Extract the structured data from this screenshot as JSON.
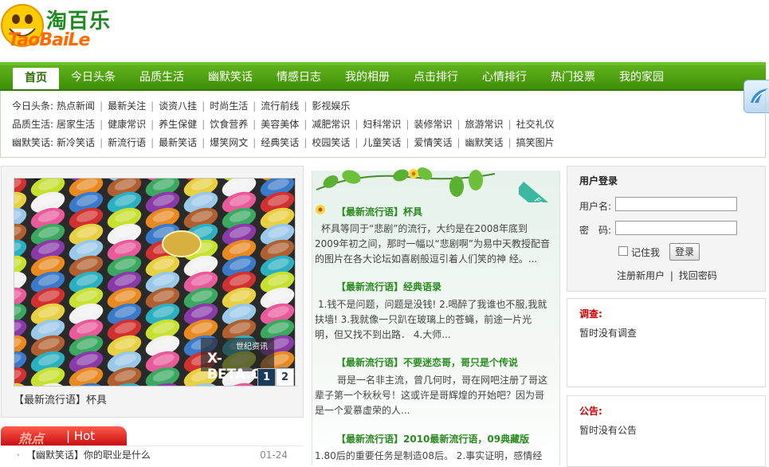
{
  "logo": {
    "cn": "淘百乐",
    "en": "TaoBaiLe"
  },
  "nav": {
    "items": [
      "首页",
      "今日头条",
      "品质生活",
      "幽默笑话",
      "情感日志",
      "我的相册",
      "点击排行",
      "心情排行",
      "热门投票",
      "我的家园"
    ],
    "active_index": 0
  },
  "submenu": {
    "rows": [
      {
        "label": "今日头条:",
        "links": [
          "热点新闻",
          "最新关注",
          "谈资八挂",
          "时尚生活",
          "流行前线",
          "影视娱乐"
        ]
      },
      {
        "label": "品质生活:",
        "links": [
          "居家生活",
          "健康常识",
          "养生保健",
          "饮食营养",
          "美容美体",
          "减肥常识",
          "妇科常识",
          "装修常识",
          "旅游常识",
          "社交礼仪"
        ]
      },
      {
        "label": "幽默笑话:",
        "links": [
          "新冷笑话",
          "新流行语",
          "最新笑话",
          "爆笑网文",
          "经典笑话",
          "校园笑话",
          "儿童笑话",
          "爱情笑话",
          "幽默笑话",
          "搞笑图片"
        ]
      }
    ]
  },
  "slideshow": {
    "caption": "【最新流行语】杯具",
    "watermark_small": "世纪资讯",
    "watermark_big": "X-BETA.CN",
    "pages": [
      "1",
      "2"
    ],
    "current_page": 1
  },
  "hot": {
    "tab_cn": "热点",
    "tab_en": "Hot",
    "items": [
      {
        "title": "【幽默笑话】你的职业是什么",
        "date": "01-24"
      }
    ]
  },
  "focus": {
    "badge": "Focus",
    "articles": [
      {
        "title": "【最新流行语】杯具",
        "body": "杯具等同于“悲剧”的流行，大约是在2008年底到2009年初之间，那时一幅以“悲剧啊”为易中天教授配音的图片在各大论坛如喜剧般逗引着人们笑的神 经。..."
      },
      {
        "title": "【最新流行语】经典语录",
        "body": "1.钱不是问题，问题是没钱!   2.喝醉了我谁也不服,我就扶墙!  3.我就像一只趴在玻璃上的苍蝇，前途一片光明，但又找不到出路．  4.大师..."
      },
      {
        "title": "【最新流行语】不要迷恋哥，哥只是个传说",
        "body": "哥是一名非主流，曾几何时，哥在网吧注册了哥这辈子第一个秋秋号！这或许是哥辉煌的开始吧？因为哥是一个爱慕虚荣的人..."
      },
      {
        "title": "【最新流行语】2010最新流行语，09典藏版",
        "body": "1.80后的重要任务是制造08后。   2.事实证明，感情经"
      }
    ]
  },
  "login": {
    "title": "用户登录",
    "username_label": "用户名:",
    "password_label": "密　码:",
    "remember_label": "记住我",
    "submit_label": "登录",
    "register_link": "注册新用户",
    "separator": "|",
    "forgot_link": "找回密码"
  },
  "survey": {
    "title": "调查:",
    "content": "暂时没有调查"
  },
  "notice": {
    "title": "公告:",
    "content": "暂时没有公告"
  }
}
